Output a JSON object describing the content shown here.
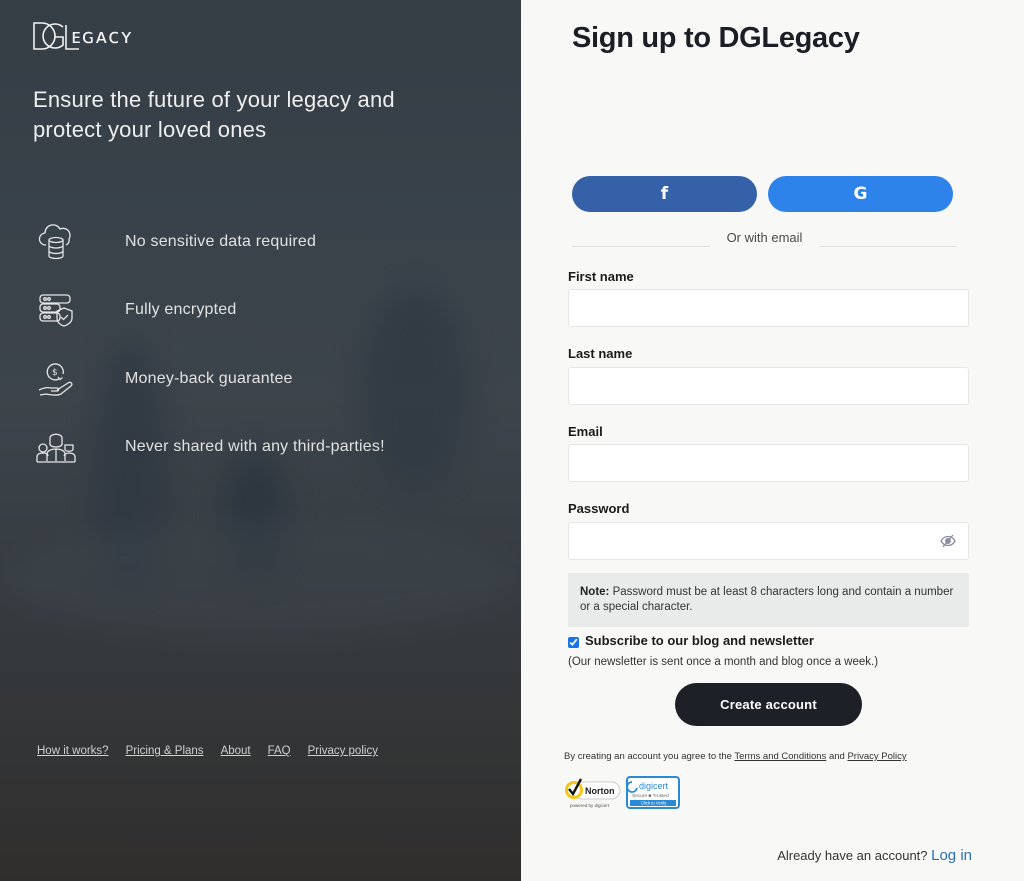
{
  "brand": {
    "logo_text": "DGLegacy",
    "tagline": "Ensure the future of your legacy and protect your loved ones"
  },
  "features": [
    {
      "icon": "cloud-database-icon",
      "text": "No sensitive data required"
    },
    {
      "icon": "server-shield-icon",
      "text": "Fully encrypted"
    },
    {
      "icon": "money-back-hand-icon",
      "text": "Money-back guarantee"
    },
    {
      "icon": "people-group-icon",
      "text": "Never shared with any third-parties!"
    }
  ],
  "footer_links": [
    "How it works?",
    "Pricing & Plans",
    "About",
    "FAQ",
    "Privacy policy"
  ],
  "form": {
    "title": "Sign up to DGLegacy",
    "facebook_label": "f",
    "google_label": "G",
    "divider_text": "Or with email",
    "fields": {
      "first_name": {
        "label": "First name",
        "value": "",
        "placeholder": ""
      },
      "last_name": {
        "label": "Last name",
        "value": "",
        "placeholder": ""
      },
      "email": {
        "label": "Email",
        "value": "",
        "placeholder": ""
      },
      "password": {
        "label": "Password",
        "value": "",
        "placeholder": ""
      }
    },
    "note_label": "Note:",
    "note_text": " Password must be at least 8 characters long and contain a number or a special character.",
    "subscribe_label": "Subscribe to our blog and newsletter",
    "subscribe_checked": true,
    "subscribe_note": "(Our newsletter is sent once a month and blog once a week.)",
    "create_button": "Create account",
    "terms_prefix": "By creating an account you agree to the ",
    "terms_link": "Terms and Conditions",
    "terms_and": " and ",
    "privacy_link": "Privacy Policy",
    "badges": {
      "norton": "Norton",
      "norton_sub": "powered by digicert",
      "digicert": "digicert",
      "digicert_sub": "Secure Trusted",
      "digicert_cta": "Click to Verify"
    },
    "login_prompt": "Already have an account? ",
    "login_link": "Log in"
  },
  "colors": {
    "facebook": "#3561a8",
    "google": "#2e83eb",
    "primary_button": "#1d2026",
    "link": "#2b6fb8"
  }
}
